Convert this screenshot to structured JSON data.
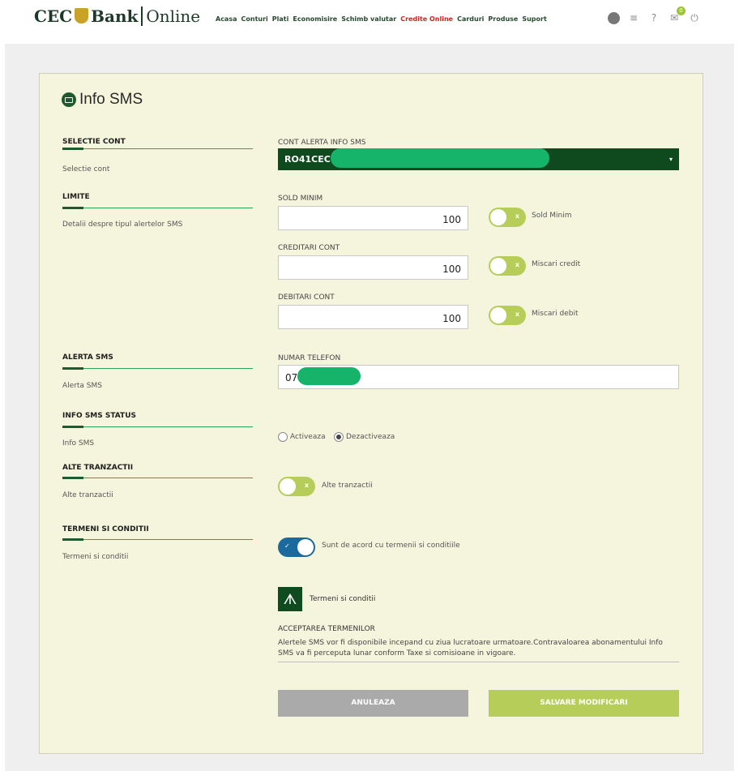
{
  "header": {
    "logo_cec": "CEC",
    "logo_bank": "Bank",
    "logo_online": "Online",
    "nav": [
      {
        "label": "Acasa",
        "active": false
      },
      {
        "label": "Conturi",
        "active": false
      },
      {
        "label": "Plati",
        "active": false
      },
      {
        "label": "Economisire",
        "active": false
      },
      {
        "label": "Schimb valutar",
        "active": false
      },
      {
        "label": "Credite Online",
        "active": true
      },
      {
        "label": "Carduri",
        "active": false
      },
      {
        "label": "Produse",
        "active": false
      },
      {
        "label": "Suport",
        "active": false
      }
    ],
    "icons": [
      "user-icon",
      "menu-icon",
      "help-icon",
      "mail-icon",
      "power-icon"
    ],
    "mail_badge": "0"
  },
  "page": {
    "title": "Info SMS",
    "title_icon": "sms-icon"
  },
  "sections": {
    "selectie_cont": {
      "head": "SELECTIE CONT",
      "sub": "Selectie cont"
    },
    "limite": {
      "head": "LIMITE",
      "sub": "Detalii despre tipul alertelor SMS"
    },
    "alerta_sms": {
      "head": "ALERTA SMS",
      "sub": "Alerta SMS"
    },
    "info_status": {
      "head": "INFO SMS STATUS",
      "sub": "Info SMS"
    },
    "alte_tranzactii": {
      "head": "ALTE TRANZACTII",
      "sub": "Alte tranzactii"
    },
    "termeni": {
      "head": "TERMENI SI CONDITII",
      "sub": "Termeni si conditii"
    }
  },
  "form": {
    "cont_label": "CONT ALERTA INFO SMS",
    "cont_value": "RO41CEC",
    "sold_label": "SOLD MINIM",
    "sold_value": "100",
    "sold_toggle_label": "Sold Minim",
    "creditari_label": "CREDITARI CONT",
    "creditari_value": "100",
    "creditari_toggle_label": "Miscari credit",
    "debitari_label": "DEBITARI CONT",
    "debitari_value": "100",
    "debitari_toggle_label": "Miscari debit",
    "telefon_label": "NUMAR TELEFON",
    "telefon_value": "076",
    "radio_activeaza": "Activeaza",
    "radio_dezactiveaza": "Dezactiveaza",
    "radio_selected": "Dezactiveaza",
    "alte_toggle_label": "Alte tranzactii",
    "termeni_toggle_label": "Sunt de acord cu termenii si conditiile",
    "toggle_off_mark": "x",
    "toggle_on_mark": "✓",
    "pdf_label": "Termeni si conditii",
    "acceptare_title": "ACCEPTAREA TERMENILOR",
    "acceptare_text": "Alertele SMS vor fi disponibile incepand cu ziua lucratoare urmatoare.Contravaloarea abonamentului Info SMS va fi perceputa lunar conform Taxe si comisioane in vigoare.",
    "cancel_label": "ANULEAZA",
    "save_label": "SALVARE MODIFICARI"
  },
  "colors": {
    "brand_dark_green": "#0f4a1e",
    "accent_lime": "#b6cd59",
    "toggle_on_blue": "#1a6aa0",
    "nav_active_red": "#d9201f",
    "panel_bg": "#f5f5dd",
    "redaction_mask": "#16b46a"
  }
}
